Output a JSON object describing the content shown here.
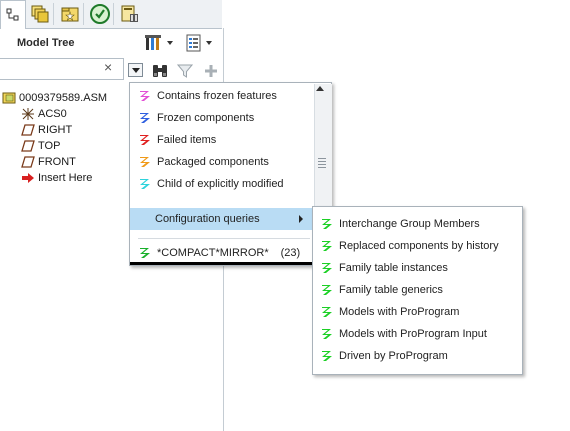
{
  "tabs": [
    {
      "icon": "model-tree-icon",
      "active": true
    },
    {
      "icon": "layers-icon",
      "active": false
    },
    {
      "icon": "favorites-folder-icon",
      "active": false
    },
    {
      "icon": "history-icon",
      "active": false
    },
    {
      "icon": "library-icon",
      "active": false
    }
  ],
  "panel": {
    "title": "Model Tree",
    "settings_icon": "tools-settings-icon",
    "columns_icon": "column-list-icon"
  },
  "search": {
    "value": "",
    "placeholder": "",
    "clear_glyph": "×"
  },
  "toolbar": {
    "find_icon": "binoculars-icon",
    "filter_icon": "funnel-icon",
    "add_icon": "plus-icon"
  },
  "tree": {
    "root": "0009379589.ASM",
    "children": [
      "ACS0",
      "RIGHT",
      "TOP",
      "FRONT",
      "Insert Here"
    ]
  },
  "filter_menu": {
    "items": [
      {
        "label": "Contains frozen features",
        "color": "#e24fd6"
      },
      {
        "label": "Frozen components",
        "color": "#2f5fe0"
      },
      {
        "label": "Failed items",
        "color": "#e02020"
      },
      {
        "label": "Packaged components",
        "color": "#f09a18"
      },
      {
        "label": "Child of explicitly modified",
        "color": "#2ed3dc"
      }
    ],
    "submenu_label": "Configuration queries",
    "saved_query": {
      "label": "*COMPACT*MIRROR*",
      "count": "(23)",
      "color": "#18b02a"
    }
  },
  "config_menu": {
    "color": "#1bd024",
    "items": [
      "Interchange Group Members",
      "Replaced components by history",
      "Family table instances",
      "Family table generics",
      "Models with ProProgram",
      "Models with ProProgram Input",
      "Driven by ProProgram"
    ]
  }
}
